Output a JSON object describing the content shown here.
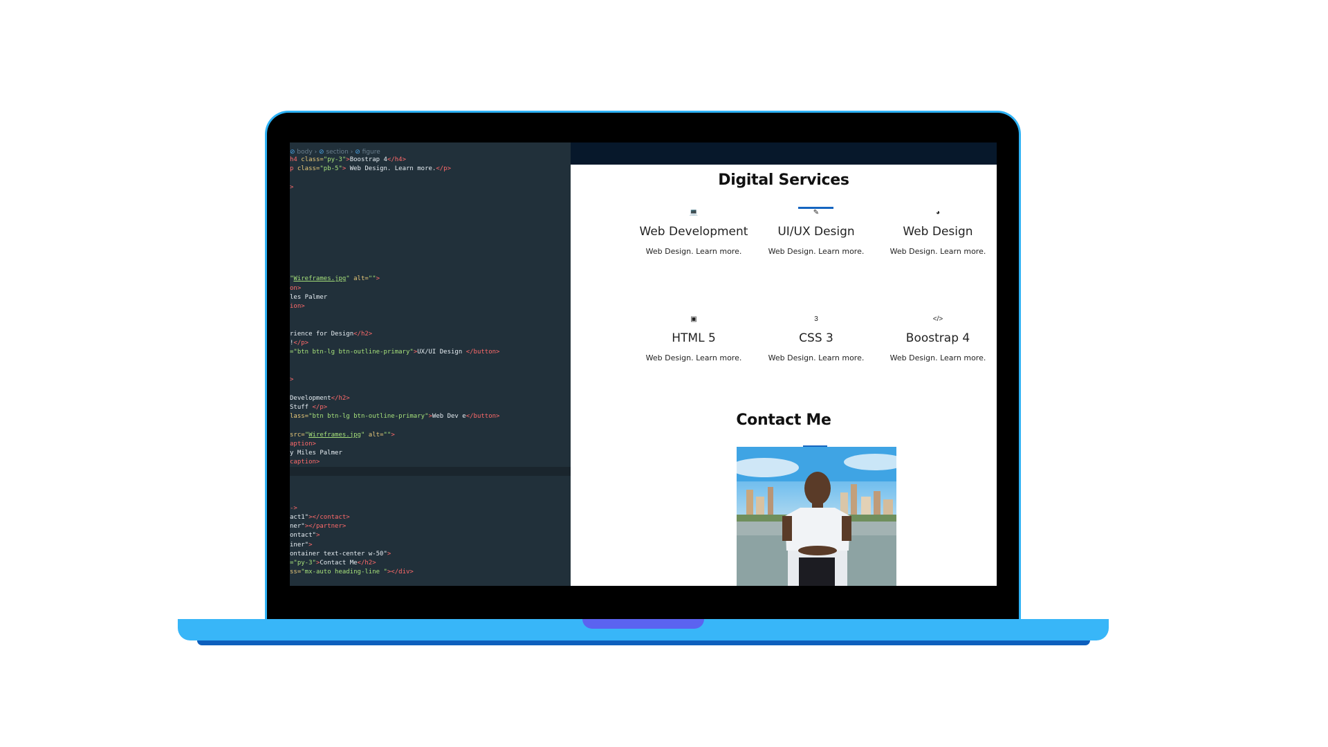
{
  "editor": {
    "breadcrumb": [
      "body",
      "section",
      "figure"
    ],
    "lines": [
      [
        [
          "tag",
          "h4 "
        ],
        [
          "attr",
          "class="
        ],
        [
          "str",
          "\"py-3\""
        ],
        [
          "tag",
          ">"
        ],
        [
          "plain",
          "Boostrap 4"
        ],
        [
          "tag",
          "</h4>"
        ]
      ],
      [
        [
          "tag",
          "p "
        ],
        [
          "attr",
          "class="
        ],
        [
          "str",
          "\"pb-5\""
        ],
        [
          "tag",
          ">"
        ],
        [
          "plain",
          " Web Design. Learn more."
        ],
        [
          "tag",
          "</p>"
        ]
      ],
      [],
      [
        [
          "tag",
          ">"
        ]
      ],
      [],
      [],
      [],
      [],
      [],
      [],
      [],
      [],
      [],
      [
        [
          "str",
          "\""
        ],
        [
          "und",
          "Wireframes.jpg"
        ],
        [
          "str",
          "\""
        ],
        [
          "attr",
          " alt="
        ],
        [
          "str",
          "\"\""
        ],
        [
          "tag",
          ">"
        ]
      ],
      [
        [
          "tag",
          "on>"
        ]
      ],
      [
        [
          "plain",
          "les Palmer"
        ]
      ],
      [
        [
          "tag",
          "ion>"
        ]
      ],
      [],
      [],
      [
        [
          "plain",
          "rience for Design"
        ],
        [
          "tag",
          "</h2>"
        ]
      ],
      [
        [
          "plain",
          "!"
        ],
        [
          "tag",
          "</p>"
        ]
      ],
      [
        [
          "str",
          "=\"btn btn-lg btn-outline-primary\""
        ],
        [
          "tag",
          ">"
        ],
        [
          "plain",
          "UX/UI Design "
        ],
        [
          "tag",
          "</button>"
        ]
      ],
      [],
      [],
      [
        [
          "tag",
          ">"
        ]
      ],
      [],
      [
        [
          "plain",
          "Development"
        ],
        [
          "tag",
          "</h2>"
        ]
      ],
      [
        [
          "plain",
          "Stuff "
        ],
        [
          "tag",
          "</p>"
        ]
      ],
      [
        [
          "attr",
          "lass="
        ],
        [
          "str",
          "\"btn btn-lg btn-outline-primary\""
        ],
        [
          "tag",
          ">"
        ],
        [
          "plain",
          "Web Dev e"
        ],
        [
          "tag",
          "</button>"
        ]
      ],
      [],
      [
        [
          "attr",
          "src="
        ],
        [
          "str",
          "\""
        ],
        [
          "und",
          "Wireframes.jpg"
        ],
        [
          "str",
          "\""
        ],
        [
          "attr",
          " alt="
        ],
        [
          "str",
          "\"\""
        ],
        [
          "tag",
          ">"
        ]
      ],
      [
        [
          "tag",
          "aption>"
        ]
      ],
      [
        [
          "plain",
          "y Miles Palmer"
        ]
      ],
      [
        [
          "tag",
          "caption>"
        ]
      ],
      [],
      [],
      [],
      [],
      [
        [
          "tag",
          "->"
        ]
      ],
      [
        [
          "plain",
          "act1\""
        ],
        [
          "tag",
          "></contact>"
        ]
      ],
      [
        [
          "plain",
          "ner\""
        ],
        [
          "tag",
          "></partner>"
        ]
      ],
      [
        [
          "plain",
          "ontact\""
        ],
        [
          "tag",
          ">"
        ]
      ],
      [
        [
          "plain",
          "iner\""
        ],
        [
          "tag",
          ">"
        ]
      ],
      [
        [
          "plain",
          "ontainer text-center w-50\""
        ],
        [
          "tag",
          ">"
        ]
      ],
      [
        [
          "str",
          "=\"py-3\""
        ],
        [
          "tag",
          ">"
        ],
        [
          "plain",
          "Contact Me"
        ],
        [
          "tag",
          "</h2>"
        ]
      ],
      [
        [
          "attr",
          "ss="
        ],
        [
          "str",
          "\"mx-auto heading-line \""
        ],
        [
          "tag",
          "></div>"
        ]
      ]
    ]
  },
  "preview": {
    "services_title": "Digital Services",
    "services": [
      {
        "icon": "laptop-icon",
        "glyph": "💻",
        "title": "Web Development",
        "desc": "Web Design. Learn more."
      },
      {
        "icon": "pencil-icon",
        "glyph": "✎",
        "title": "UI/UX Design",
        "desc": "Web Design. Learn more."
      },
      {
        "icon": "pie-chart-icon",
        "glyph": "◕",
        "title": "Web Design",
        "desc": "Web Design. Learn more."
      },
      {
        "icon": "briefcase-icon",
        "glyph": "▣",
        "title": "HTML 5",
        "desc": "Web Design. Learn more."
      },
      {
        "icon": "css3-icon",
        "glyph": "3",
        "title": "CSS 3",
        "desc": "Web Design. Learn more."
      },
      {
        "icon": "code-icon",
        "glyph": "</>",
        "title": "Boostrap 4",
        "desc": "Web Design. Learn more."
      }
    ],
    "contact_title": "Contact Me"
  },
  "colors": {
    "laptop_blue": "#38b6f8",
    "navbar": "#07182b",
    "heading_line": "#1565c0",
    "editor_bg": "#21303a"
  }
}
